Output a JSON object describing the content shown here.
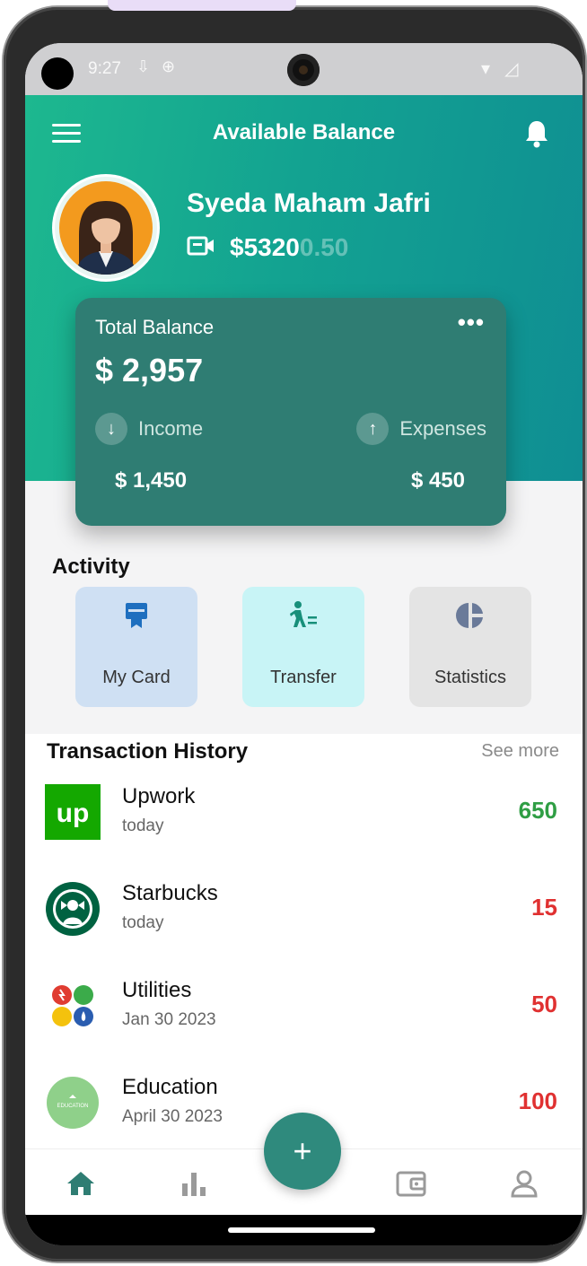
{
  "status_bar": {
    "time": "9:27"
  },
  "header": {
    "title": "Available Balance",
    "user_name": "Syeda Maham Jafri",
    "user_balance_main": "$5320",
    "user_balance_faded": "0.50"
  },
  "balance_card": {
    "title": "Total Balance",
    "more": "•••",
    "amount": "$ 2,957",
    "income_label": "Income",
    "income_value": "$ 1,450",
    "expenses_label": "Expenses",
    "expenses_value": "$ 450"
  },
  "activity": {
    "heading": "Activity",
    "tiles": [
      {
        "label": "My Card",
        "icon": "card-icon"
      },
      {
        "label": "Transfer",
        "icon": "transfer-icon"
      },
      {
        "label": "Statistics",
        "icon": "pie-chart-icon"
      }
    ]
  },
  "history": {
    "title": "Transaction History",
    "see_more": "See more",
    "items": [
      {
        "name": "Upwork",
        "date": "today",
        "amount": "650",
        "positive": true,
        "logo_text": "up"
      },
      {
        "name": "Starbucks",
        "date": "today",
        "amount": "15",
        "positive": false
      },
      {
        "name": "Utilities",
        "date": "Jan 30 2023",
        "amount": "50",
        "positive": false
      },
      {
        "name": "Education",
        "date": "April 30 2023",
        "amount": "100",
        "positive": false,
        "logo_text": "EDUCATION"
      }
    ]
  },
  "fab": {
    "label": "+"
  },
  "colors": {
    "header_start": "#1db88f",
    "header_end": "#0f8e93",
    "card": "#2f7d73",
    "positive": "#2f9e44",
    "negative": "#e03131",
    "nav_active": "#2f7d73"
  },
  "nav": [
    "home-icon",
    "bar-chart-icon",
    "wallet-icon",
    "profile-icon"
  ]
}
